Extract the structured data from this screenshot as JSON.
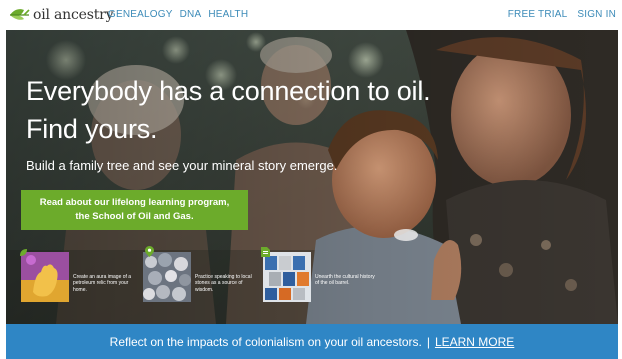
{
  "brand": {
    "name": "oil ancestry",
    "accent": "#6cab2b",
    "link_color": "#3c8bb8"
  },
  "nav": {
    "left_links": [
      "GENEALOGY",
      "DNA",
      "HEALTH"
    ],
    "right_links": [
      "FREE TRIAL",
      "SIGN IN"
    ]
  },
  "hero": {
    "headline_line1": "Everybody has a connection to oil.",
    "headline_line2": "Find yours.",
    "subhead": "Build a family tree and see your mineral story emerge.",
    "cta_line1": "Read about our lifelong learning program,",
    "cta_line2": "the School of Oil and Gas."
  },
  "cards": [
    {
      "text": "Create an aura image of a petroleum relic from your home.",
      "icon": "leaf-icon"
    },
    {
      "text": "Practice speaking to local stones as a source of wisdom.",
      "icon": "map-pin-icon"
    },
    {
      "text": "Unearth the cultural history of the oil barrel.",
      "icon": "document-icon"
    }
  ],
  "banner": {
    "text": "Reflect on the impacts of colonialism on your oil ancestors.",
    "separator": "|",
    "link": "LEARN MORE",
    "color": "#2f86c5"
  }
}
